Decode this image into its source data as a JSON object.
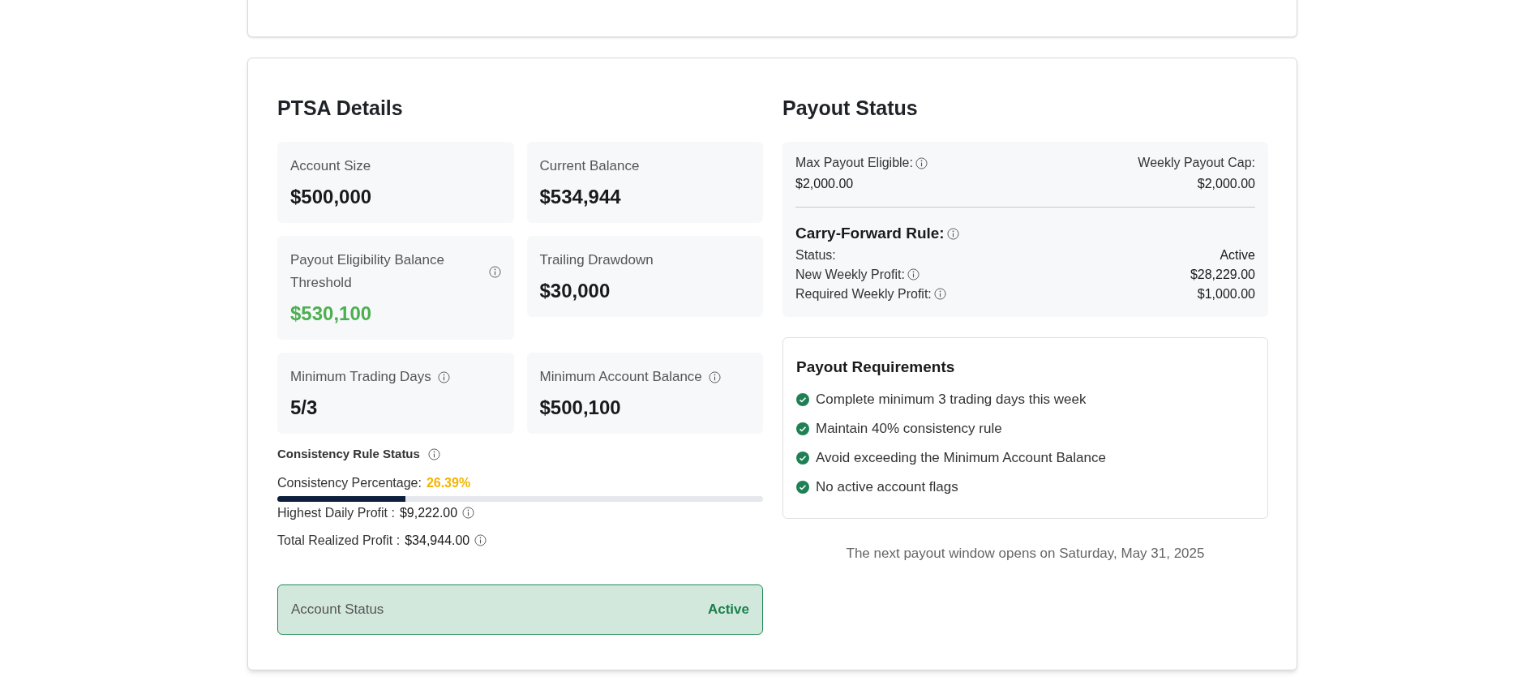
{
  "details": {
    "title": "PTSA Details",
    "cards": [
      {
        "label": "Account Size",
        "value": "$500,000",
        "info": false,
        "highlight": false
      },
      {
        "label": "Current Balance",
        "value": "$534,944",
        "info": false,
        "highlight": false
      },
      {
        "label": "Payout Eligibility Balance Threshold",
        "value": "$530,100",
        "info": true,
        "highlight": true
      },
      {
        "label": "Trailing Drawdown",
        "value": "$30,000",
        "info": false,
        "highlight": false
      },
      {
        "label": "Minimum Trading Days",
        "value": "5/3",
        "info": true,
        "highlight": false
      },
      {
        "label": "Minimum Account Balance",
        "value": "$500,100",
        "info": true,
        "highlight": false
      }
    ],
    "consistency": {
      "title": "Consistency Rule Status",
      "percentage_label": "Consistency Percentage:",
      "percentage": "26.39%",
      "level": 0.2639,
      "lines": [
        {
          "label": "Highest Daily Profit :",
          "value": "$9,222.00"
        },
        {
          "label": "Total Realized Profit :",
          "value": "$34,944.00"
        }
      ]
    },
    "account_status": {
      "label": "Account Status",
      "value": "Active"
    }
  },
  "payout": {
    "title": "Payout Status",
    "max_label": "Max Payout Eligible:",
    "max_value": "$2,000.00",
    "cap_label": "Weekly Payout Cap:",
    "cap_value": "$2,000.00",
    "carry_title": "Carry-Forward Rule:",
    "carry_rows": [
      {
        "label": "Status:",
        "value": "Active",
        "info": false
      },
      {
        "label": "New Weekly Profit:",
        "value": "$28,229.00",
        "info": true
      },
      {
        "label": "Required Weekly Profit:",
        "value": "$1,000.00",
        "info": true
      }
    ],
    "requirements": {
      "title": "Payout Requirements",
      "items": [
        {
          "text": "Complete minimum 3 trading days this week",
          "checked": true
        },
        {
          "text": "Maintain 40% consistency rule",
          "checked": true
        },
        {
          "text": "Avoid exceeding the Minimum Account Balance",
          "checked": true
        },
        {
          "text": "No active account flags",
          "checked": true
        }
      ]
    },
    "footer": "The next payout window opens on Saturday, May 31, 2025"
  }
}
